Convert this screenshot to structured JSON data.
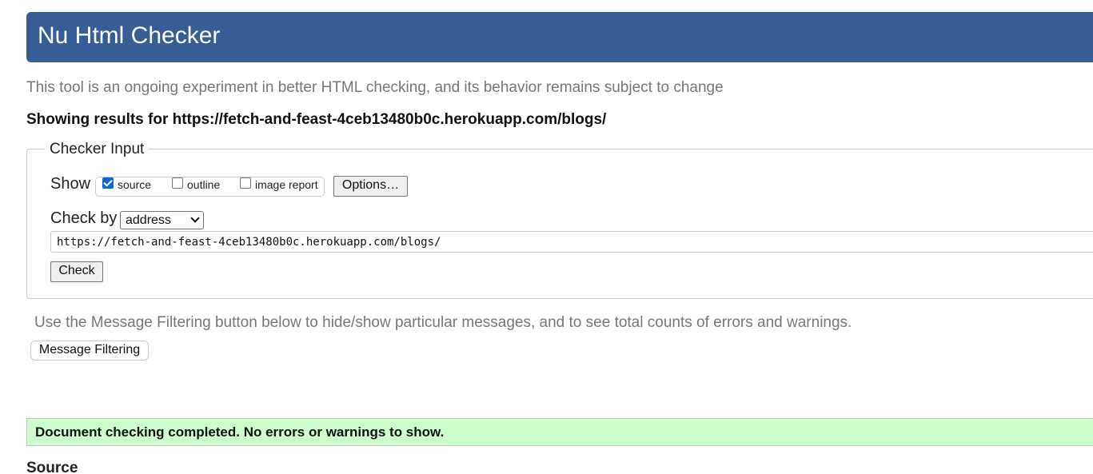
{
  "header": {
    "title": "Nu Html Checker"
  },
  "tagline": "This tool is an ongoing experiment in better HTML checking, and its behavior remains subject to change",
  "showing_results": "Showing results for https://fetch-and-feast-4ceb13480b0c.herokuapp.com/blogs/",
  "checker_input": {
    "legend": "Checker Input",
    "show_label": "Show",
    "show_options": [
      {
        "label": "source",
        "checked": true
      },
      {
        "label": "outline",
        "checked": false
      },
      {
        "label": "image report",
        "checked": false
      }
    ],
    "options_button": "Options…",
    "check_by_label": "Check by",
    "check_by_selected": "address",
    "url_value": "https://fetch-and-feast-4ceb13480b0c.herokuapp.com/blogs/",
    "check_button": "Check"
  },
  "filter_note": "Use the Message Filtering button below to hide/show particular messages, and to see total counts of errors and warnings.",
  "filter_button": "Message Filtering",
  "result_message": "Document checking completed. No errors or warnings to show.",
  "source_heading": "Source",
  "colors": {
    "header_bg": "#365d95",
    "success_bg": "#ccffcc",
    "checkbox_accent": "#0b66d6"
  }
}
